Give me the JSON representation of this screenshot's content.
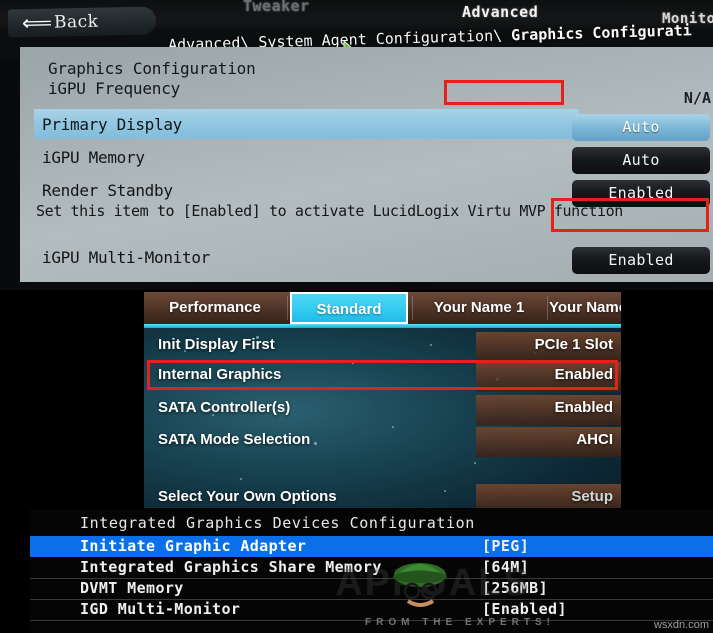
{
  "panel1": {
    "back_label": "Back",
    "back_icon": "back-arrow-icon",
    "tabs": {
      "tweaker": "Tweaker",
      "advanced": "Advanced",
      "monitor": "Monitor"
    },
    "breadcrumb_plain": "Advanced\\ System Agent Configuration\\ ",
    "breadcrumb_strong": "Graphics Configurati",
    "heading_1": "Graphics Configuration",
    "heading_2": "iGPU Frequency",
    "frequency_value": "N/A",
    "rows": [
      {
        "label": "Primary Display",
        "value": "Auto",
        "selected": true
      },
      {
        "label": "iGPU Memory",
        "value": "Auto",
        "selected": false
      },
      {
        "label": "Render Standby",
        "value": "Enabled",
        "selected": false
      }
    ],
    "help_text": "Set this item to [Enabled] to activate LucidLogix Virtu MVP function",
    "multimonitor": {
      "label": "iGPU Multi-Monitor",
      "value": "Enabled",
      "highlight": "#e32219"
    }
  },
  "panel2": {
    "tabs": [
      {
        "label": "Performance",
        "active": false
      },
      {
        "label": "Standard",
        "active": true
      },
      {
        "label": "Your Name 1",
        "active": false
      },
      {
        "label": "Your Name",
        "active": false
      }
    ],
    "accent_color": "#33c9ef",
    "rows": [
      {
        "label": "Init Display First",
        "value": "PCIe 1 Slot",
        "highlighted": false
      },
      {
        "label": "Internal Graphics",
        "value": "Enabled",
        "highlighted": true
      },
      {
        "label": "SATA Controller(s)",
        "value": "Enabled",
        "highlighted": false
      },
      {
        "label": "SATA Mode Selection",
        "value": "AHCI",
        "highlighted": false
      },
      {
        "label": "Select Your Own Options",
        "value": "Setup",
        "highlighted": false
      }
    ]
  },
  "panel3": {
    "title": "Integrated Graphics Devices Configuration",
    "selection_color": "#0b6fe8",
    "rows": [
      {
        "label": "Initiate Graphic Adapter",
        "value": "[PEG]",
        "selected": true
      },
      {
        "label": "Integrated Graphics Share Memory",
        "value": "[64M]",
        "selected": false
      },
      {
        "label": "DVMT Memory",
        "value": "[256MB]",
        "selected": false
      },
      {
        "label": "IGD Multi-Monitor",
        "value": "[Enabled]",
        "selected": false,
        "highlighted": true
      }
    ]
  },
  "watermark": {
    "logo_text": "APPUALS",
    "tagline": "FROM THE EXPERTS!",
    "site": "wsxdn.com"
  }
}
